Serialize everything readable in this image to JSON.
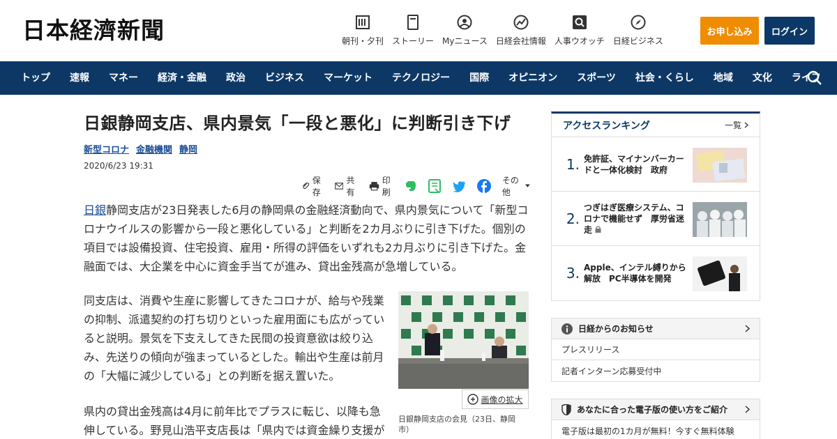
{
  "header": {
    "logo": "日本経濟新聞",
    "nav": [
      {
        "label": "朝刊・夕刊",
        "icon": "newspaper-icon"
      },
      {
        "label": "ストーリー",
        "icon": "book-icon"
      },
      {
        "label": "Myニュース",
        "icon": "user-icon"
      },
      {
        "label": "日経会社情報",
        "icon": "chart-icon"
      },
      {
        "label": "人事ウオッチ",
        "icon": "search-person-icon"
      },
      {
        "label": "日経ビジネス",
        "icon": "compass-icon"
      }
    ],
    "apply_label": "お申し込み",
    "login_label": "ログイン"
  },
  "mainnav": [
    "トップ",
    "速報",
    "マネー",
    "経済・金融",
    "政治",
    "ビジネス",
    "マーケット",
    "テクノロジー",
    "国際",
    "オピニオン",
    "スポーツ",
    "社会・くらし",
    "地域",
    "文化",
    "ライフ"
  ],
  "article": {
    "title": "日銀静岡支店、県内景気「一段と悪化」に判断引き下げ",
    "tags": [
      "新型コロナ",
      "金融機関",
      "静岡"
    ],
    "date": "2020/6/23 19:31",
    "share": {
      "save": "保存",
      "share": "共有",
      "print": "印刷",
      "more": "その他"
    },
    "lead_link": "日銀",
    "lead_rest": "静岡支店が23日発表した6月の静岡県の金融経済動向で、県内景気について「新型コロナウイルスの影響から一段と悪化している」と判断を2カ月ぶりに引き下げた。個別の項目では設備投資、住宅投資、雇用・所得の評価をいずれも2カ月ぶりに引き下げた。金融面では、大企業を中心に資金手当てが進み、貸出金残高が急増している。",
    "para2": "同支店は、消費や生産に影響してきたコロナが、給与や残業の抑制、派遣契約の打ち切りといった雇用面にも広がっていると説明。景気を下支えしてきた民間の投資意欲は絞り込み、先送りの傾向が強まっているとした。輸出や生産は前月の「大幅に減少している」との判断を据え置いた。",
    "para3": "県内の貸出金残高は4月に前年比でプラスに転じ、以降も急伸している。野見山浩平支店長は「県内では資金繰り支援が",
    "enlarge": "画像の拡大",
    "caption": "日銀静岡支店の会見（23日、静岡市）"
  },
  "ranking": {
    "title": "アクセスランキング",
    "more": "一覧",
    "items": [
      {
        "num": "1.",
        "text": "免許証、マイナンバーカードと一体化検討　政府"
      },
      {
        "num": "2.",
        "text": "つぎはぎ医療システム、コロナで機能せず　厚労省迷走"
      },
      {
        "num": "3.",
        "text": "Apple、インテル縛りから解放　PC半導体を開発"
      }
    ]
  },
  "notice": {
    "title": "日経からのお知らせ",
    "rows": [
      "プレスリリース",
      "記者インターン応募受付中"
    ]
  },
  "guide": {
    "title": "あなたに合った電子版の使い方をご紹介",
    "row": "電子版は最初の1カ月が無料！今すぐ無料体験"
  },
  "colors": {
    "navy": "#0d3866",
    "orange": "#f08c00",
    "link": "#1a4d96"
  }
}
